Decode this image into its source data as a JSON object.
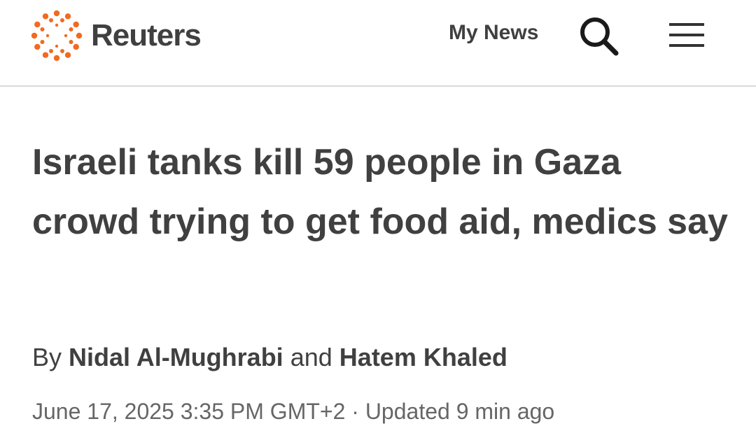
{
  "header": {
    "brand": "Reuters",
    "brand_color": "#f26a21",
    "my_news_label": "My News",
    "search_icon": "search-icon",
    "menu_icon": "hamburger-menu-icon"
  },
  "article": {
    "headline": "Israeli tanks kill 59 people in Gaza crowd trying to get food aid, medics say",
    "byline_prefix": "By",
    "author_1": "Nidal Al-Mughrabi",
    "byline_joiner": "and",
    "author_2": "Hatem Khaled",
    "date": "June 17, 2025 3:35 PM GMT+2",
    "separator": "·",
    "updated": "Updated 9 min ago"
  }
}
